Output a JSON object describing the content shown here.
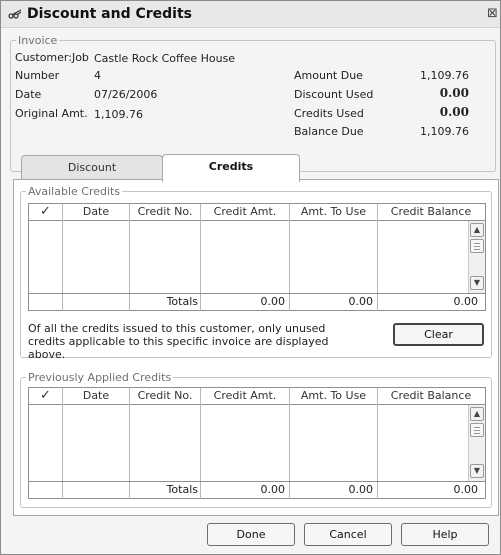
{
  "window": {
    "title": "Discount and Credits",
    "icon": "scissors-icon",
    "close_glyph": "⊠"
  },
  "invoice": {
    "legend": "Invoice",
    "customer_label": "Customer:Job",
    "customer_value": "Castle Rock Coffee House",
    "number_label": "Number",
    "number_value": "4",
    "date_label": "Date",
    "date_value": "07/26/2006",
    "original_label": "Original Amt.",
    "original_value": "1,109.76",
    "amount_due_label": "Amount Due",
    "amount_due_value": "1,109.76",
    "discount_used_label": "Discount Used",
    "discount_used_value": "0.00",
    "credits_used_label": "Credits Used",
    "credits_used_value": "0.00",
    "balance_due_label": "Balance Due",
    "balance_due_value": "1,109.76"
  },
  "tabs": [
    {
      "label": "Discount",
      "active": false
    },
    {
      "label": "Credits",
      "active": true
    }
  ],
  "available_credits": {
    "legend": "Available Credits",
    "columns": [
      "✓",
      "Date",
      "Credit No.",
      "Credit Amt.",
      "Amt. To Use",
      "Credit Balance"
    ],
    "rows": [],
    "totals_label": "Totals",
    "totals": {
      "credit_amt": "0.00",
      "amt_to_use": "0.00",
      "credit_balance": "0.00"
    },
    "note": "Of all the credits issued to this customer, only unused credits applicable to this specific invoice are displayed above.",
    "clear_button": "Clear"
  },
  "previously_applied": {
    "legend": "Previously Applied Credits",
    "columns": [
      "✓",
      "Date",
      "Credit No.",
      "Credit Amt.",
      "Amt. To Use",
      "Credit Balance"
    ],
    "rows": [],
    "totals_label": "Totals",
    "totals": {
      "credit_amt": "0.00",
      "amt_to_use": "0.00",
      "credit_balance": "0.00"
    }
  },
  "buttons": {
    "done": "Done",
    "cancel": "Cancel",
    "help": "Help"
  },
  "scroll_glyphs": {
    "up": "▲",
    "down": "▼"
  }
}
